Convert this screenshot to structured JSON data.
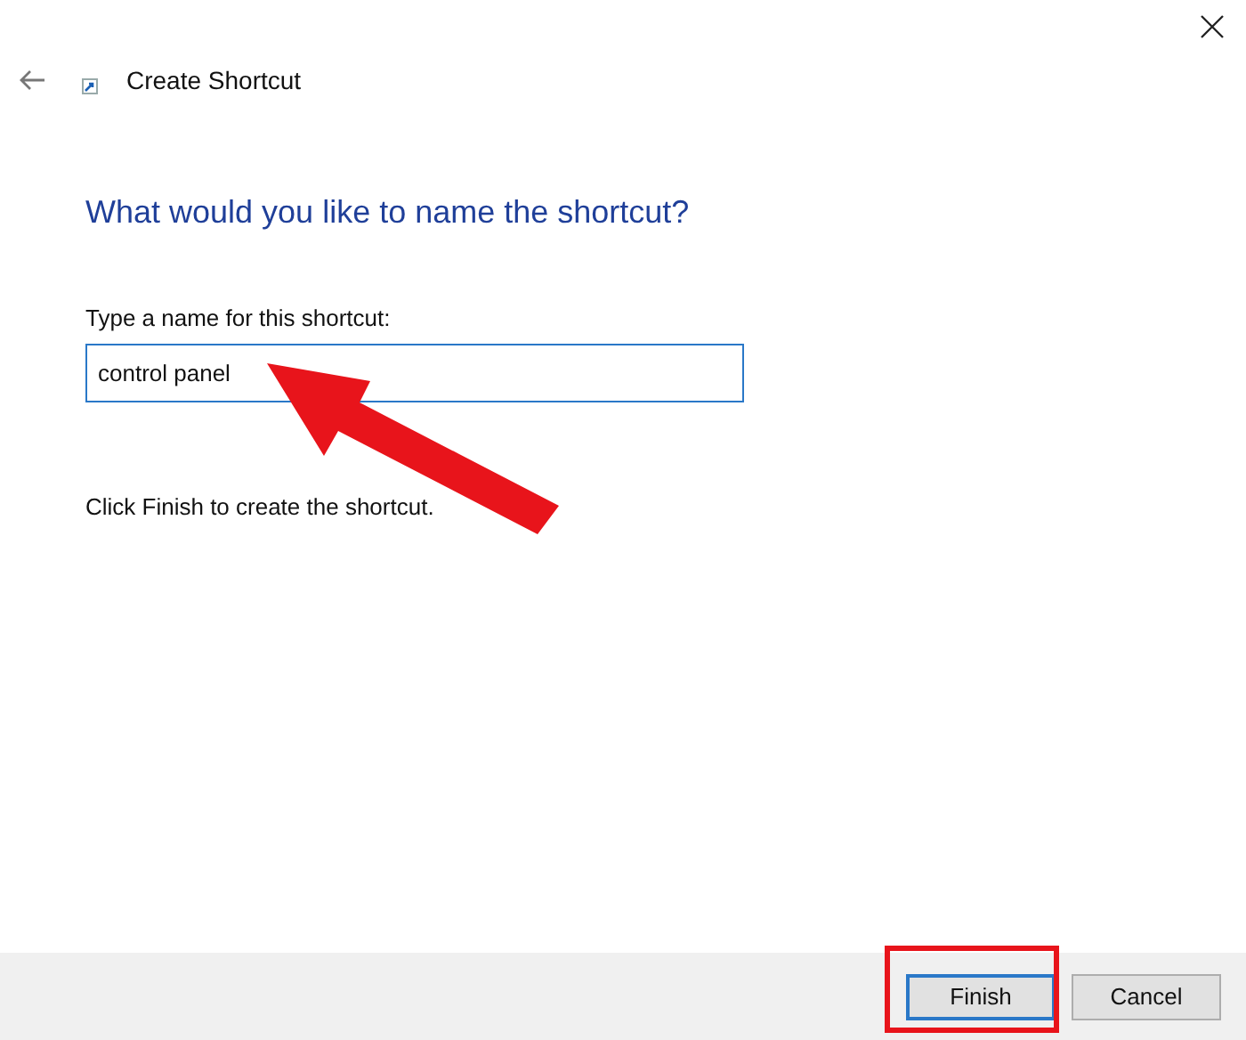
{
  "window": {
    "title": "Create Shortcut"
  },
  "heading": "What would you like to name the shortcut?",
  "name_field": {
    "label": "Type a name for this shortcut:",
    "value": "control panel"
  },
  "hint": "Click Finish to create the shortcut.",
  "buttons": [
    {
      "label": "Finish",
      "kind": "default"
    },
    {
      "label": "Cancel",
      "kind": "normal"
    }
  ]
}
